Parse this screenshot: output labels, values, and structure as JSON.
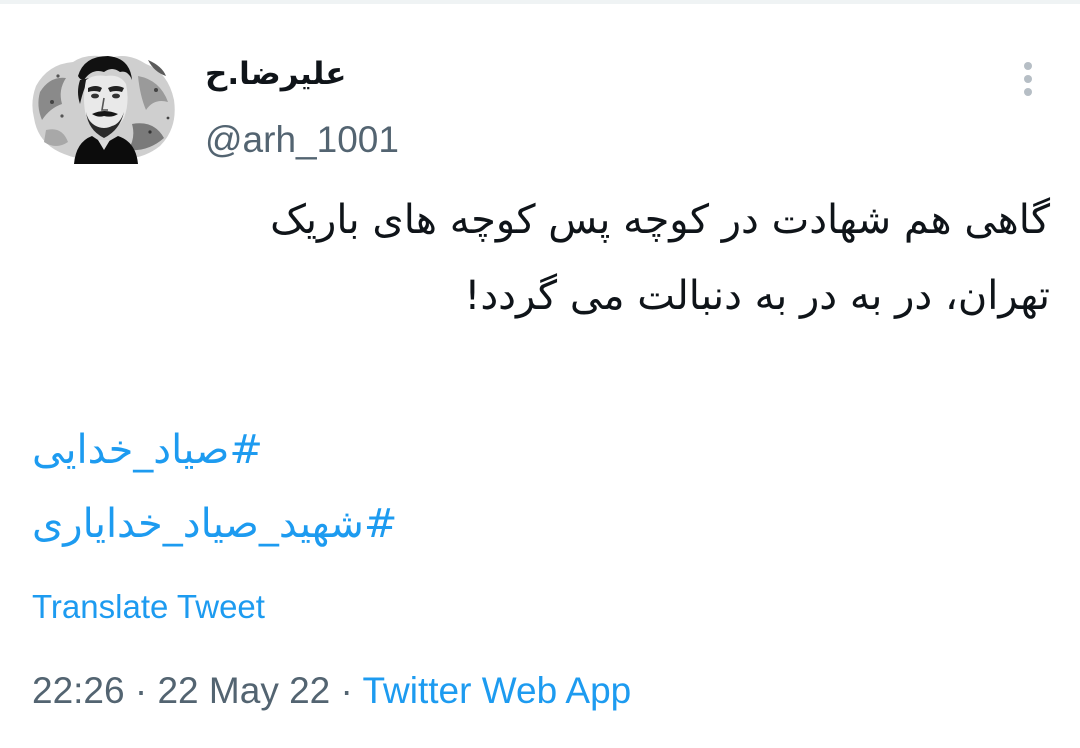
{
  "tweet": {
    "author": {
      "display_name": "علیرضا.ح",
      "handle": "@arh_1001"
    },
    "more_icon": "more-vertical-icon",
    "text_lines": [
      "گاهی هم شهادت در کوچه پس کوچه های باریک",
      "تهران، در به در به دنبالت می گردد!"
    ],
    "hashtags": [
      "#صیاد_خدایی",
      "#شهید_صیاد_خدایاری"
    ],
    "translate_label": "Translate Tweet",
    "time": "22:26",
    "date": "22 May 22",
    "separator": "·",
    "source": "Twitter Web App"
  },
  "colors": {
    "link": "#1d9bf0",
    "secondary_text": "#536471",
    "primary_text": "#0f1419"
  }
}
